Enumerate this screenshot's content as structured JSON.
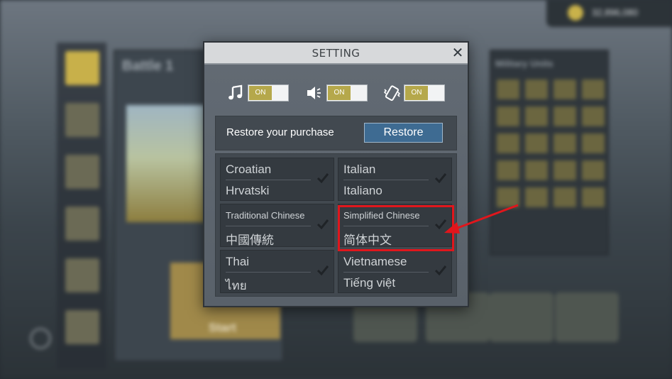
{
  "background": {
    "money": "32,896,080",
    "battle_title": "Battle 1",
    "start_label": "Start",
    "right_panel_title": "Military Units"
  },
  "dialog": {
    "title": "SETTING",
    "close_icon": "close-icon",
    "toggles": [
      {
        "icon": "music-note-icon",
        "state": "ON"
      },
      {
        "icon": "speaker-icon",
        "state": "ON"
      },
      {
        "icon": "vibration-icon",
        "state": "ON"
      }
    ],
    "restore": {
      "label": "Restore your purchase",
      "button": "Restore"
    },
    "languages": [
      {
        "name": "Croatian",
        "native": "Hrvatski"
      },
      {
        "name": "Italian",
        "native": "Italiano"
      },
      {
        "name": "Traditional Chinese",
        "native": "中國傳統"
      },
      {
        "name": "Simplified Chinese",
        "native": "简体中文"
      },
      {
        "name": "Thai",
        "native": "ไทย"
      },
      {
        "name": "Vietnamese",
        "native": "Tiếng việt"
      }
    ]
  },
  "colors": {
    "accent_toggle": "#b5a84b",
    "restore_button": "#3e6b92",
    "highlight": "#e0161c"
  }
}
